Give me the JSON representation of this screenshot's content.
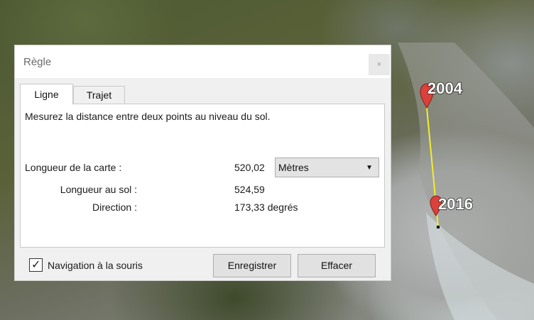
{
  "dialog": {
    "title": "Règle",
    "close_symbol": "×",
    "tabs": [
      {
        "label": "Ligne",
        "active": true
      },
      {
        "label": "Trajet",
        "active": false
      }
    ],
    "description": "Mesurez la distance entre deux points au niveau du sol.",
    "rows": [
      {
        "label": "Longueur de la carte :",
        "value": "520,02"
      },
      {
        "label": "Longueur au sol :",
        "value": "524,59"
      },
      {
        "label": "Direction :",
        "value": "173,33 degrés"
      }
    ],
    "unit_select": {
      "selected": "Mètres"
    },
    "mouse_nav": {
      "label": "Navigation à la souris",
      "checked": true
    },
    "buttons": {
      "save": "Enregistrer",
      "clear": "Effacer"
    }
  },
  "map": {
    "markers": [
      {
        "label": "2004",
        "color": "#d9413a"
      },
      {
        "label": "2016",
        "color": "#d9413a"
      }
    ],
    "line_color": "#f2ee2a"
  }
}
